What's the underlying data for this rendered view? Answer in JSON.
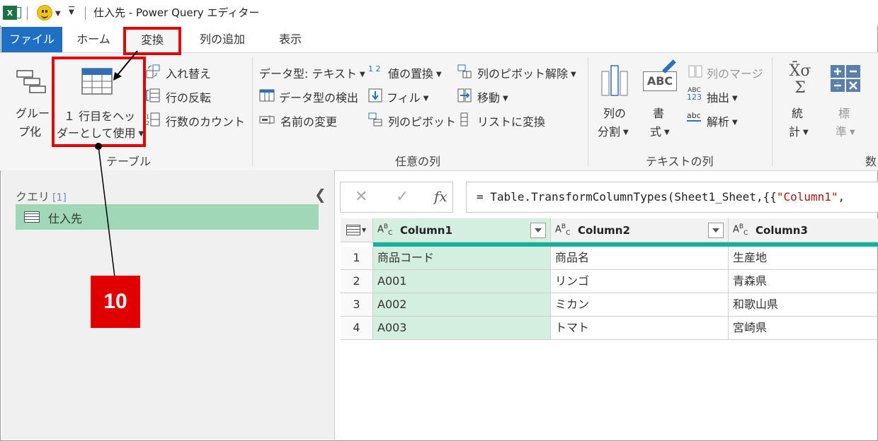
{
  "titlebar": {
    "title": "仕入先 - Power Query エディター",
    "app_icon": "X"
  },
  "tabs": [
    {
      "label": "ファイル",
      "state": "file"
    },
    {
      "label": "ホーム",
      "state": "normal"
    },
    {
      "label": "変換",
      "state": "active"
    },
    {
      "label": "列の追加",
      "state": "normal"
    },
    {
      "label": "表示",
      "state": "normal"
    }
  ],
  "ribbon": {
    "table_group": {
      "label": "テーブル",
      "group_by": [
        "グルー",
        "プ化"
      ],
      "first_row_header": [
        "１ 行目をヘッ",
        "ダーとして使用"
      ],
      "transpose": "入れ替え",
      "reverse_rows": "行の反転",
      "count_rows": "行数のカウント"
    },
    "any_column": {
      "label": "任意の列",
      "data_type": "データ型: テキスト",
      "detect_type": "データ型の検出",
      "rename": "名前の変更",
      "replace_values": "値の置換",
      "fill": "フィル",
      "pivot": "列のピボット",
      "unpivot": "列のピボット解除",
      "move": "移動",
      "to_list": "リストに変換",
      "replace_prefix": "1 2"
    },
    "text_column": {
      "label": "テキストの列",
      "split": [
        "列の",
        "分割"
      ],
      "format": [
        "書",
        "式"
      ],
      "merge": "列のマージ",
      "extract": "抽出",
      "parse": "解析",
      "abc_icon": "ABC",
      "num_icon_top": "ABC",
      "num_icon_bottom": "123",
      "parse_icon": "abc"
    },
    "number_column": {
      "label": "数",
      "stats": [
        "統",
        "計"
      ],
      "standard": [
        "標",
        "準"
      ],
      "sigma_glyph": "X̄σ",
      "sum_glyph": "Σ"
    }
  },
  "queries": {
    "title": "クエリ",
    "count": "[1]",
    "items": [
      {
        "name": "仕入先"
      }
    ]
  },
  "formula": {
    "cancel_glyph": "✕",
    "commit_glyph": "✓",
    "fx_glyph": "fx",
    "expr_prefix": "= Table.TransformColumnTypes(Sheet1_Sheet,{{",
    "expr_string": "\"Column1\"",
    "expr_suffix": ","
  },
  "grid": {
    "type_prefix_a": "A",
    "type_prefix_b": "B",
    "type_prefix_c": "C",
    "columns": [
      "Column1",
      "Column2",
      "Column3"
    ],
    "rows": [
      {
        "num": "1",
        "cells": [
          "商品コード",
          "商品名",
          "生産地"
        ]
      },
      {
        "num": "2",
        "cells": [
          "A001",
          "リンゴ",
          "青森県"
        ]
      },
      {
        "num": "3",
        "cells": [
          "A002",
          "ミカン",
          "和歌山県"
        ]
      },
      {
        "num": "4",
        "cells": [
          "A003",
          "トマト",
          "宮崎県"
        ]
      }
    ]
  },
  "annotation": {
    "step": "10",
    "color": "#e00000"
  },
  "colors": {
    "file_tab": "#1f6fc5",
    "selected_column": "#d4eee0",
    "quality_bar": "#13b09c",
    "query_selected": "#9fd7b7"
  }
}
